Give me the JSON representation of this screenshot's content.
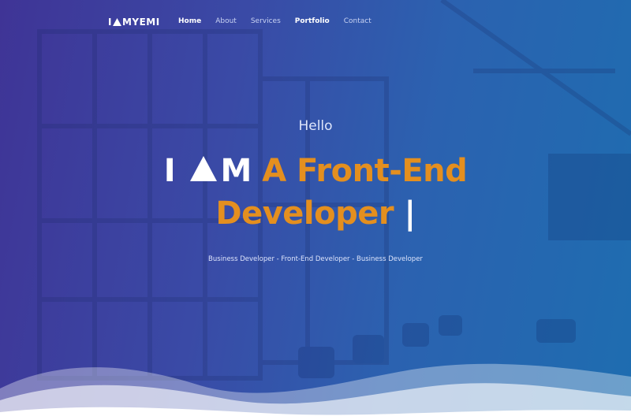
{
  "nav": {
    "logo_left": "I",
    "logo_right": "MYEMI",
    "items": [
      {
        "label": "Home",
        "active": true
      },
      {
        "label": "About",
        "active": false
      },
      {
        "label": "Services",
        "active": false
      },
      {
        "label": "Portfolio",
        "active": true
      },
      {
        "label": "Contact",
        "active": false
      }
    ]
  },
  "hero": {
    "greeting": "Hello",
    "line1_white_left": "I",
    "line1_white_right": "M",
    "line1_orange": "A Front-End",
    "line2_orange": "Developer",
    "cursor": "|",
    "subline": "Business Developer - Front-End Developer - Business Developer"
  },
  "colors": {
    "accent": "#e48f1f",
    "bg_left": "#3f3496",
    "bg_right": "#1e6db0"
  }
}
